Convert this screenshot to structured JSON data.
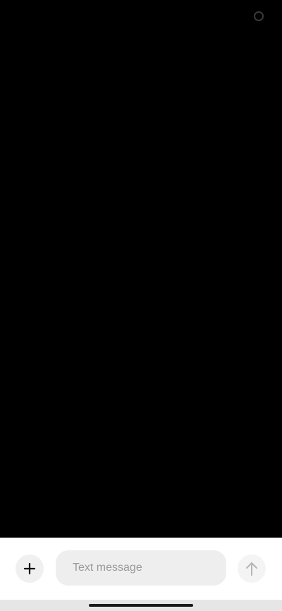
{
  "composer": {
    "placeholder": "Text message",
    "value": "",
    "add_icon": "plus-icon",
    "send_icon": "arrow-up-icon"
  },
  "colors": {
    "background": "#000000",
    "composer_bg": "#ffffff",
    "input_bg": "#eeeeee",
    "placeholder": "#9a9a9a"
  }
}
